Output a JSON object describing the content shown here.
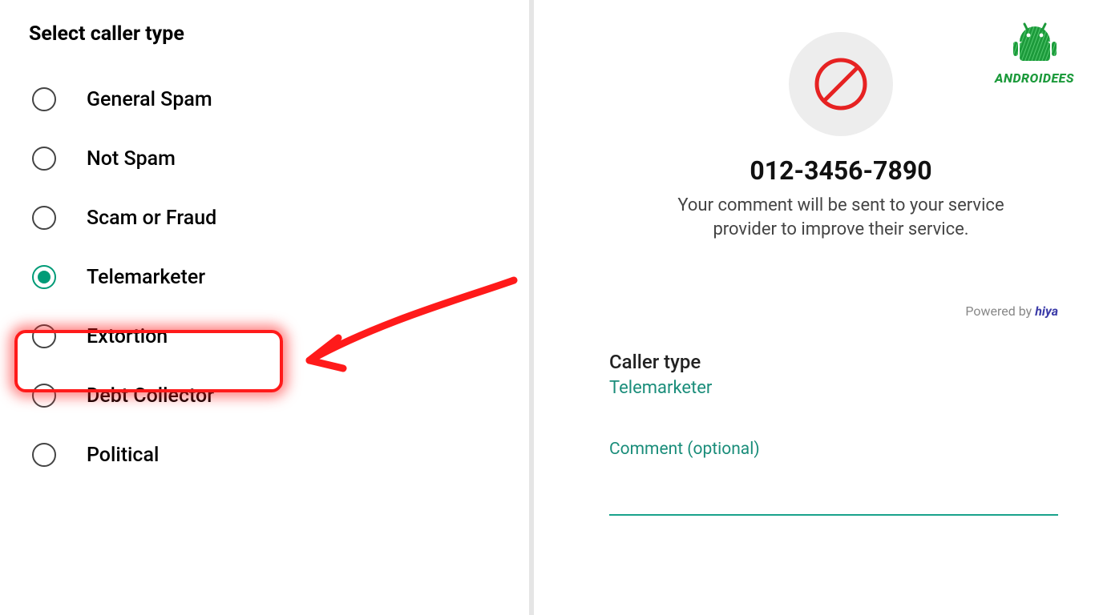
{
  "left": {
    "title": "Select caller type",
    "options": [
      {
        "label": "General Spam",
        "selected": false
      },
      {
        "label": "Not Spam",
        "selected": false
      },
      {
        "label": "Scam or Fraud",
        "selected": false
      },
      {
        "label": "Telemarketer",
        "selected": true
      },
      {
        "label": "Extortion",
        "selected": false
      },
      {
        "label": "Debt Collector",
        "selected": false
      },
      {
        "label": "Political",
        "selected": false
      }
    ]
  },
  "right": {
    "phone": "012-3456-7890",
    "description_l1": "Your comment will be sent to your service",
    "description_l2": "provider to improve their service.",
    "powered_prefix": "Powered by ",
    "powered_brand": "hiya",
    "caller_type_label": "Caller type",
    "caller_type_value": "Telemarketer",
    "comment_label": "Comment (optional)",
    "comment_value": ""
  },
  "logo": {
    "name": "ANDROIDEES"
  }
}
